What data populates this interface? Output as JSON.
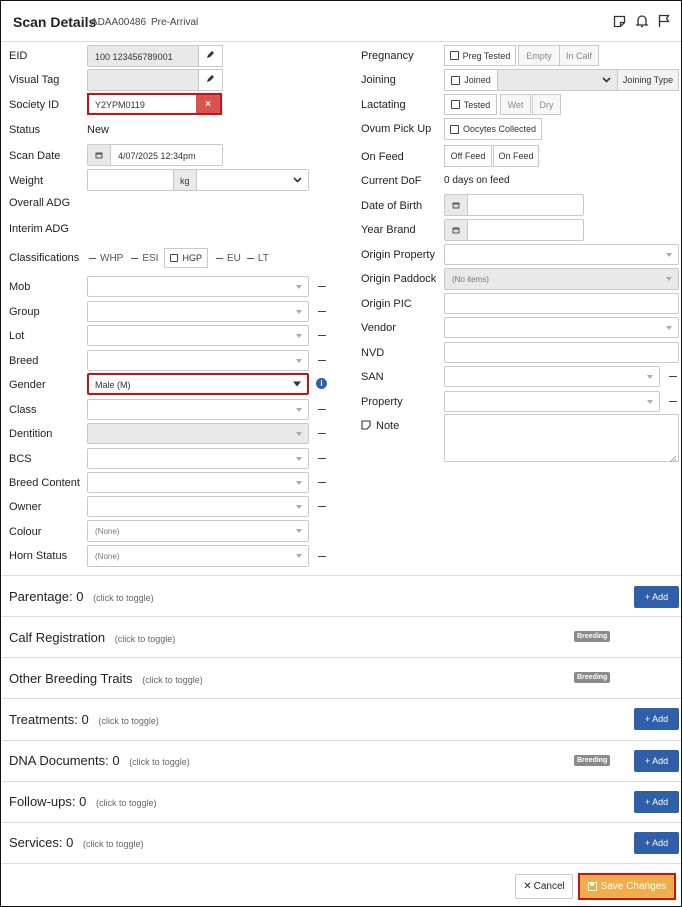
{
  "header": {
    "title": "Scan Details",
    "scan_id": "ADAA00486",
    "status": "Pre-Arrival"
  },
  "left": {
    "eid": {
      "label": "EID",
      "value": "100 123456789001"
    },
    "visual_tag": {
      "label": "Visual Tag",
      "value": ""
    },
    "society_id": {
      "label": "Society ID",
      "value": "Y2YPM0119"
    },
    "status": {
      "label": "Status",
      "value": "New"
    },
    "scan_date": {
      "label": "Scan Date",
      "value": "4/07/2025 12:34pm"
    },
    "weight": {
      "label": "Weight",
      "unit": "kg"
    },
    "overall_adg": {
      "label": "Overall ADG"
    },
    "interim_adg": {
      "label": "Interim ADG"
    },
    "classifications": {
      "label": "Classifications",
      "whp": "WHP",
      "esi": "ESI",
      "hgp": "HGP",
      "eu": "EU",
      "lt": "LT"
    },
    "mob": {
      "label": "Mob"
    },
    "group": {
      "label": "Group"
    },
    "lot": {
      "label": "Lot"
    },
    "breed": {
      "label": "Breed"
    },
    "gender": {
      "label": "Gender",
      "value": "Male (M)"
    },
    "class": {
      "label": "Class"
    },
    "dentition": {
      "label": "Dentition"
    },
    "bcs": {
      "label": "BCS"
    },
    "breed_content": {
      "label": "Breed Content"
    },
    "owner": {
      "label": "Owner"
    },
    "colour": {
      "label": "Colour",
      "value": "(None)"
    },
    "horn_status": {
      "label": "Horn Status",
      "value": "(None)"
    }
  },
  "right": {
    "pregnancy": {
      "label": "Pregnancy",
      "preg_tested": "Preg Tested",
      "empty": "Empty",
      "in_calf": "In Calf"
    },
    "joining": {
      "label": "Joining",
      "joined": "Joined",
      "joining_type": "Joining Type"
    },
    "lactating": {
      "label": "Lactating",
      "tested": "Tested",
      "wet": "Wet",
      "dry": "Dry"
    },
    "ovum": {
      "label": "Ovum Pick Up",
      "oocytes": "Oocytes Collected"
    },
    "on_feed": {
      "label": "On Feed",
      "off_feed": "Off Feed",
      "on_feed_btn": "On Feed"
    },
    "current_dof": {
      "label": "Current DoF",
      "value": "0 days on feed"
    },
    "dob": {
      "label": "Date of Birth"
    },
    "year_brand": {
      "label": "Year Brand"
    },
    "origin_property": {
      "label": "Origin Property"
    },
    "origin_paddock": {
      "label": "Origin Paddock",
      "value": "(No items)"
    },
    "origin_pic": {
      "label": "Origin PIC"
    },
    "vendor": {
      "label": "Vendor"
    },
    "nvd": {
      "label": "NVD"
    },
    "san": {
      "label": "SAN"
    },
    "property": {
      "label": "Property"
    },
    "note": {
      "label": "Note"
    }
  },
  "sections": {
    "hint": "(click to toggle)",
    "add_label": "+ Add",
    "breeding_badge": "Breeding",
    "parentage": {
      "title": "Parentage:",
      "count": "0"
    },
    "calf_registration": {
      "title": "Calf Registration"
    },
    "other_breeding": {
      "title": "Other Breeding Traits"
    },
    "treatments": {
      "title": "Treatments:",
      "count": "0"
    },
    "dna": {
      "title": "DNA Documents:",
      "count": "0"
    },
    "followups": {
      "title": "Follow-ups:",
      "count": "0"
    },
    "services": {
      "title": "Services:",
      "count": "0"
    }
  },
  "footer": {
    "cancel": "Cancel",
    "save": "Save Changes"
  },
  "colors": {
    "accent_blue": "#2f5fa8",
    "save_orange": "#f0ad4e",
    "highlight_red": "#cc1111",
    "danger_red": "#d9534f"
  }
}
